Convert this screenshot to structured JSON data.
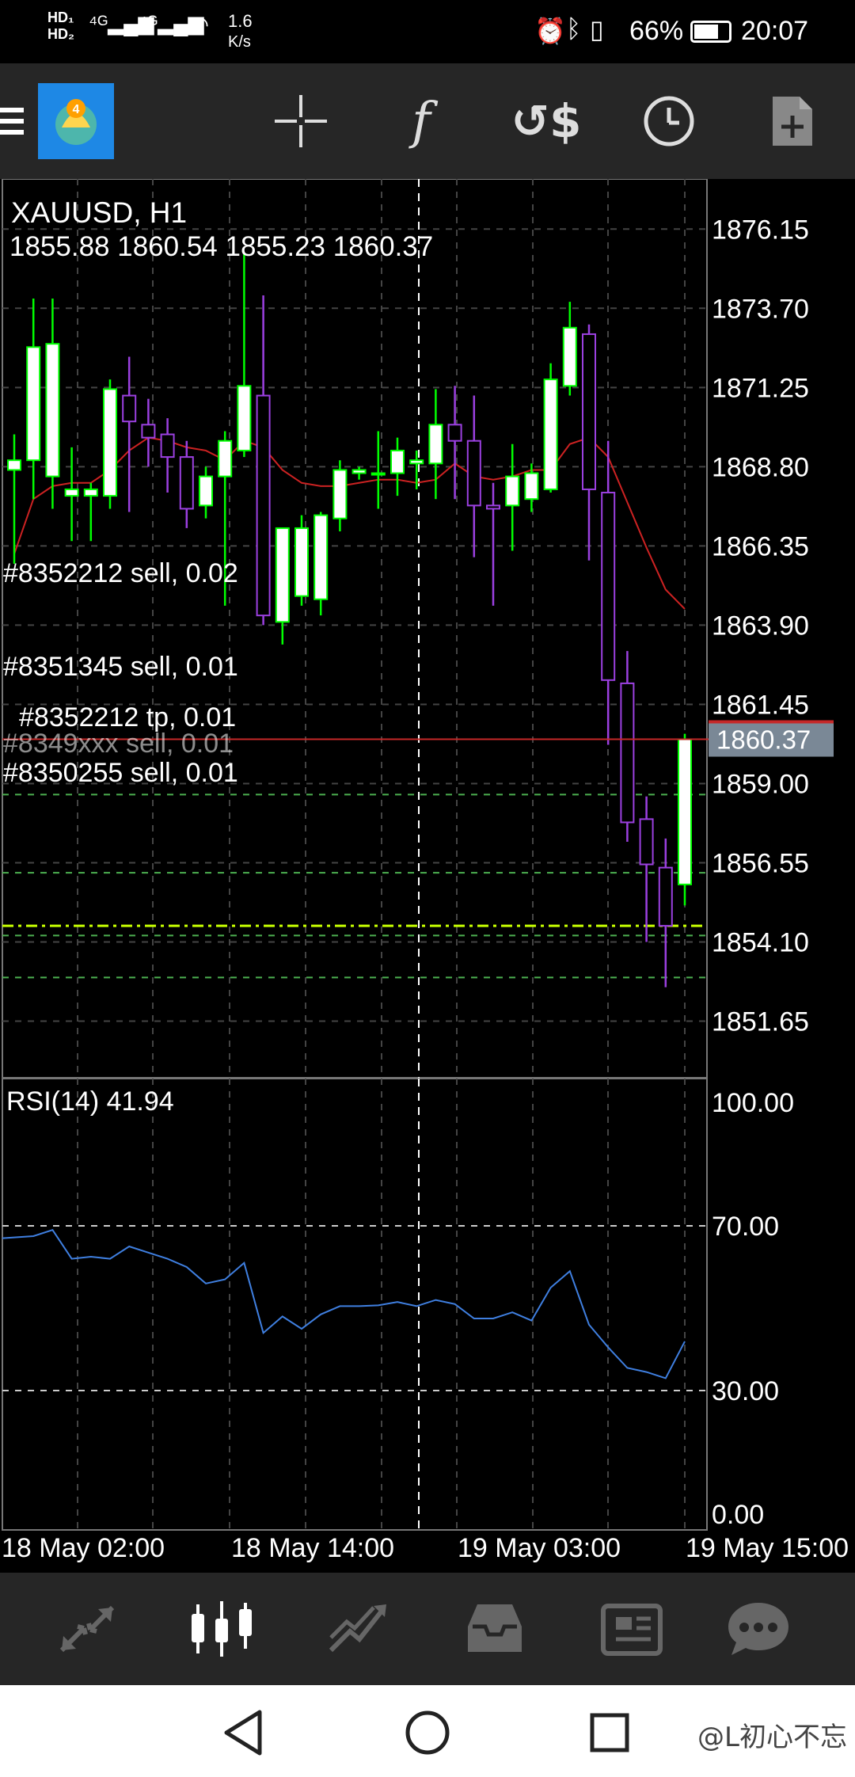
{
  "status_bar": {
    "network_speed": "1.6",
    "network_unit": "K/s",
    "battery": "66%",
    "time": "20:07"
  },
  "toolbar": {
    "menu_icon": "hamburger-icon",
    "app_icon": "metatrader-4-icon",
    "buttons": [
      "crosshair-icon",
      "function-icon",
      "symbol-dollar-icon",
      "clock-icon",
      "new-document-icon"
    ]
  },
  "chart": {
    "symbol_title": "XAUUSD, H1",
    "ohlc": "1855.88 1860.54 1855.23 1860.37",
    "current_price": "1860.37",
    "orders": [
      {
        "label": "#8352212 sell, 0.02",
        "price": 1858.66
      },
      {
        "label": "#8351345 sell, 0.01",
        "price": 1856.24
      },
      {
        "label": "#8352212 tp, 0.01",
        "price": 1854.6
      },
      {
        "label": "#8349xxx sell, 0.01",
        "price": 1854.3
      },
      {
        "label": "#8350255 sell, 0.01",
        "price": 1853.0
      }
    ],
    "indicator_title": "RSI(14) 41.94",
    "rsi_levels": [
      "100.00",
      "70.00",
      "30.00",
      "0.00"
    ],
    "time_labels": [
      "18 May 02:00",
      "18 May 14:00",
      "19 May 03:00",
      "19 May 15:00"
    ]
  },
  "chart_data": {
    "type": "candlestick",
    "title": "XAUUSD, H1",
    "ylim": [
      1849.9,
      1877.7
    ],
    "price_ticks": [
      1876.15,
      1873.7,
      1871.25,
      1868.8,
      1866.35,
      1863.9,
      1861.45,
      1859.0,
      1856.55,
      1854.1,
      1851.65
    ],
    "price_tick_labels": [
      "1876.15",
      "1873.70",
      "1871.25",
      "1868.80",
      "1866.35",
      "1863.90",
      "1861.45",
      "1859.00",
      "1856.55",
      "1854.10",
      "1851.65"
    ],
    "candles": [
      {
        "o": 1868.7,
        "h": 1869.8,
        "l": 1865.8,
        "c": 1869.0
      },
      {
        "o": 1869.0,
        "h": 1874.0,
        "l": 1867.8,
        "c": 1872.5
      },
      {
        "o": 1868.5,
        "h": 1874.0,
        "l": 1867.5,
        "c": 1872.6
      },
      {
        "o": 1867.9,
        "h": 1869.4,
        "l": 1866.5,
        "c": 1868.1
      },
      {
        "o": 1867.9,
        "h": 1868.3,
        "l": 1866.5,
        "c": 1868.1
      },
      {
        "o": 1867.9,
        "h": 1871.5,
        "l": 1867.5,
        "c": 1871.2
      },
      {
        "o": 1871.0,
        "h": 1872.2,
        "l": 1867.4,
        "c": 1870.2
      },
      {
        "o": 1870.1,
        "h": 1870.9,
        "l": 1868.8,
        "c": 1869.7
      },
      {
        "o": 1869.8,
        "h": 1870.3,
        "l": 1868.0,
        "c": 1869.1
      },
      {
        "o": 1869.1,
        "h": 1869.6,
        "l": 1866.9,
        "c": 1867.5
      },
      {
        "o": 1867.6,
        "h": 1868.8,
        "l": 1867.2,
        "c": 1868.5
      },
      {
        "o": 1868.5,
        "h": 1869.9,
        "l": 1864.5,
        "c": 1869.6
      },
      {
        "o": 1869.3,
        "h": 1875.4,
        "l": 1869.1,
        "c": 1871.3
      },
      {
        "o": 1871.0,
        "h": 1874.1,
        "l": 1863.9,
        "c": 1864.2
      },
      {
        "o": 1864.0,
        "h": 1866.5,
        "l": 1863.3,
        "c": 1866.9
      },
      {
        "o": 1864.8,
        "h": 1867.3,
        "l": 1864.5,
        "c": 1866.9
      },
      {
        "o": 1864.7,
        "h": 1867.4,
        "l": 1864.2,
        "c": 1867.3
      },
      {
        "o": 1867.2,
        "h": 1869.0,
        "l": 1866.8,
        "c": 1868.7
      },
      {
        "o": 1868.6,
        "h": 1868.8,
        "l": 1868.4,
        "c": 1868.7
      },
      {
        "o": 1868.6,
        "h": 1869.9,
        "l": 1867.5,
        "c": 1868.6
      },
      {
        "o": 1868.6,
        "h": 1869.7,
        "l": 1867.9,
        "c": 1869.3
      },
      {
        "o": 1868.9,
        "h": 1869.3,
        "l": 1868.1,
        "c": 1869.0
      },
      {
        "o": 1868.9,
        "h": 1871.2,
        "l": 1867.8,
        "c": 1870.1
      },
      {
        "o": 1870.1,
        "h": 1871.3,
        "l": 1867.8,
        "c": 1869.6
      },
      {
        "o": 1869.6,
        "h": 1871.0,
        "l": 1866.0,
        "c": 1867.6
      },
      {
        "o": 1867.6,
        "h": 1868.3,
        "l": 1864.5,
        "c": 1867.5
      },
      {
        "o": 1867.6,
        "h": 1869.5,
        "l": 1866.2,
        "c": 1868.5
      },
      {
        "o": 1867.8,
        "h": 1868.9,
        "l": 1867.4,
        "c": 1868.6
      },
      {
        "o": 1868.1,
        "h": 1872.0,
        "l": 1868.0,
        "c": 1871.5
      },
      {
        "o": 1871.3,
        "h": 1873.9,
        "l": 1871.0,
        "c": 1873.1
      },
      {
        "o": 1872.9,
        "h": 1873.2,
        "l": 1865.9,
        "c": 1868.1
      },
      {
        "o": 1868.0,
        "h": 1869.6,
        "l": 1860.2,
        "c": 1862.2
      },
      {
        "o": 1862.1,
        "h": 1863.1,
        "l": 1857.2,
        "c": 1857.8
      },
      {
        "o": 1857.9,
        "h": 1858.6,
        "l": 1854.1,
        "c": 1856.5
      },
      {
        "o": 1856.4,
        "h": 1857.3,
        "l": 1852.7,
        "c": 1854.6
      },
      {
        "o": 1855.88,
        "h": 1860.54,
        "l": 1855.23,
        "c": 1860.37
      }
    ],
    "ma": [
      1866.1,
      1867.8,
      1868.2,
      1868.3,
      1868.3,
      1868.7,
      1869.3,
      1869.7,
      1869.6,
      1869.4,
      1869.3,
      1869.0,
      1869.6,
      1869.4,
      1868.7,
      1868.3,
      1868.2,
      1868.2,
      1868.3,
      1868.4,
      1868.4,
      1868.3,
      1868.4,
      1868.9,
      1868.5,
      1868.4,
      1868.5,
      1868.7,
      1868.7,
      1869.5,
      1869.7,
      1869.1,
      1867.7,
      1866.3,
      1865.0,
      1864.4
    ],
    "rsi": [
      67,
      67.5,
      69,
      62,
      62.5,
      62,
      65,
      63.5,
      62,
      60,
      56,
      57,
      61,
      44,
      48,
      45,
      48.5,
      50.5,
      50.5,
      50.7,
      51.5,
      50.5,
      52,
      51,
      47.5,
      47.5,
      49,
      47,
      55,
      59,
      46,
      40.5,
      35.5,
      34.5,
      33,
      41.94
    ],
    "rsi_ylim": [
      0,
      100
    ]
  },
  "colors": {
    "bull": "#ffffff",
    "bear": "#000000",
    "candle_edge": "#00ff00",
    "wick_up": "#00ff00",
    "wick_down": "#9b40e0",
    "ma_line": "#cc2222",
    "rsi_line": "#3f7fe0",
    "price_line": "#c62828",
    "order_line": "#4caf50",
    "tp_line": "#c6ff00"
  },
  "bottom_tabs": [
    "quotes-icon",
    "chart-icon",
    "trade-icon",
    "history-icon",
    "news-icon",
    "messages-icon"
  ],
  "nav_bar": [
    "back-icon",
    "home-icon",
    "recent-apps-icon"
  ],
  "watermark": "@L初心不忘"
}
